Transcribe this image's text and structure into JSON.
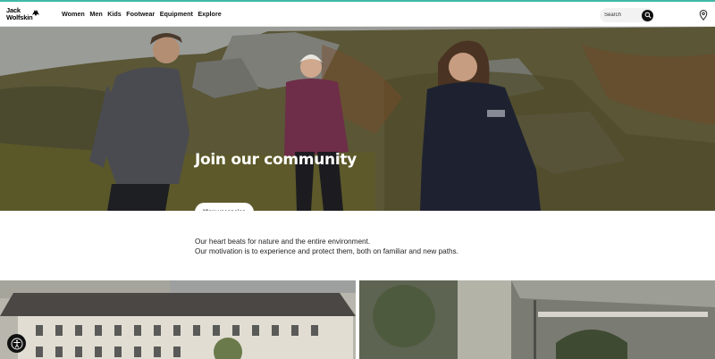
{
  "brand": {
    "logo_line1": "Jack",
    "logo_line2": "Wolfskin",
    "accent_color": "#3fb8a4"
  },
  "nav": {
    "items": [
      {
        "label": "Women"
      },
      {
        "label": "Men"
      },
      {
        "label": "Kids"
      },
      {
        "label": "Footwear"
      },
      {
        "label": "Equipment"
      },
      {
        "label": "Explore"
      }
    ]
  },
  "search": {
    "placeholder": "Search",
    "icon": "search-icon"
  },
  "store_locator": {
    "icon": "location-pin-icon"
  },
  "hero": {
    "title": "Join our community",
    "cta_label": "View vacancies"
  },
  "intro": {
    "line1": "Our heart beats for nature and the entire environment.",
    "line2": "Our motivation is to experience and protect them, both on familiar and new paths."
  },
  "accessibility": {
    "icon": "accessibility-icon"
  }
}
